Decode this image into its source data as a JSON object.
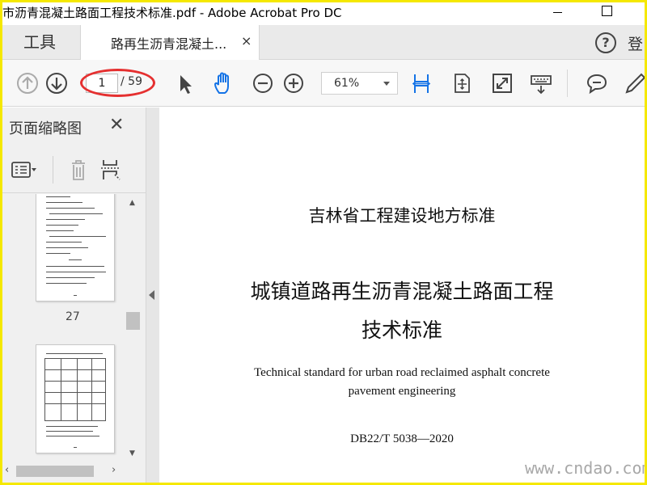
{
  "window": {
    "title": "市沥青混凝土路面工程技术标准.pdf - Adobe Acrobat Pro DC"
  },
  "tabs": {
    "tools_label": "工具",
    "document_label": "路再生沥青混凝土...",
    "close_glyph": "×",
    "help_glyph": "?",
    "login_label": "登"
  },
  "toolbar": {
    "current_page": "1",
    "total_pages": "/ 59",
    "zoom": "61%"
  },
  "sidebar": {
    "title": "页面缩略图",
    "close_glyph": "✕",
    "thumbnail_page_number": "27"
  },
  "document": {
    "line1": "吉林省工程建设地方标准",
    "line2": "城镇道路再生沥青混凝土路面工程",
    "line3": "技术标准",
    "english_line1": "Technical standard for urban road reclaimed asphalt concrete",
    "english_line2": "pavement engineering",
    "code": "DB22/T 5038—2020"
  },
  "watermark": "www.cndao.com",
  "icons": {
    "prev_page": "arrow-up-circle-icon",
    "next_page": "arrow-down-circle-icon",
    "select": "pointer-icon",
    "hand": "hand-icon",
    "zoom_out": "minus-circle-icon",
    "zoom_in": "plus-circle-icon",
    "fit_width": "fit-width-icon",
    "fit_page": "fit-page-icon",
    "full_screen": "full-screen-icon",
    "keyboard": "keyboard-icon",
    "comment": "comment-icon",
    "pen": "pen-icon"
  },
  "colors": {
    "accent_blue": "#1473e6",
    "annotation_red": "#e53030",
    "frame_yellow": "#f5e800"
  }
}
